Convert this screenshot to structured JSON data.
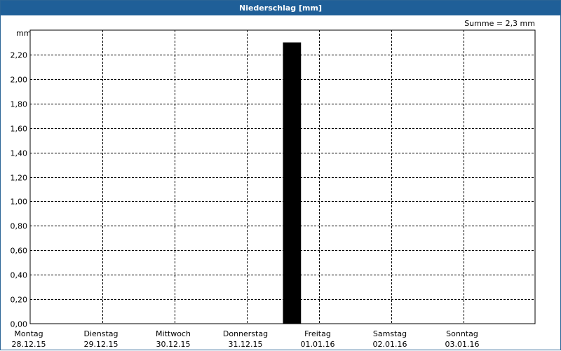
{
  "window": {
    "title": "Niederschlag [mm]"
  },
  "summary": "Summe = 2,3 mm",
  "colors": {
    "titlebar": "#1f5f98",
    "bar": "#000000",
    "grid": "#000000"
  },
  "chart_data": {
    "type": "bar",
    "title": "Niederschlag [mm]",
    "ylabel": "mm",
    "xlabel": "",
    "ylim": [
      0,
      2.3
    ],
    "y_ticks": [
      0,
      0.2,
      0.4,
      0.6,
      0.8,
      1.0,
      1.2,
      1.4,
      1.6,
      1.8,
      2.0,
      2.2
    ],
    "y_tick_labels": [
      "0,00",
      "0,20",
      "0,40",
      "0,60",
      "0,80",
      "1,00",
      "1,20",
      "1,40",
      "1,60",
      "1,80",
      "2,00",
      "2,20"
    ],
    "x_ticks": [
      {
        "day": "Montag",
        "date": "28.12.15"
      },
      {
        "day": "Dienstag",
        "date": "29.12.15"
      },
      {
        "day": "Mittwoch",
        "date": "30.12.15"
      },
      {
        "day": "Donnerstag",
        "date": "31.12.15"
      },
      {
        "day": "Freitag",
        "date": "01.01.16"
      },
      {
        "day": "Samstag",
        "date": "02.01.16"
      },
      {
        "day": "Sonntag",
        "date": "03.01.16"
      }
    ],
    "bars": [
      {
        "start": "31.12.15 12:00",
        "end": "31.12.15 18:00",
        "value": 2.3
      }
    ],
    "grid": true
  }
}
